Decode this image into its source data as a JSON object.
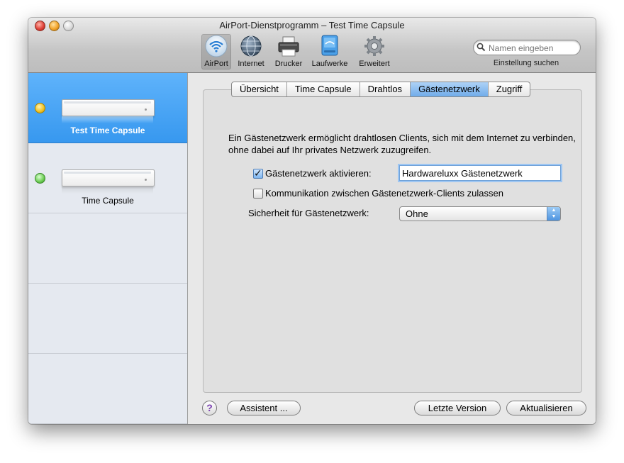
{
  "window": {
    "title": "AirPort-Dienstprogramm – Test Time Capsule"
  },
  "toolbar": {
    "items": [
      {
        "label": "AirPort",
        "icon": "airport-icon",
        "selected": true
      },
      {
        "label": "Internet",
        "icon": "globe-icon"
      },
      {
        "label": "Drucker",
        "icon": "printer-icon"
      },
      {
        "label": "Laufwerke",
        "icon": "disk-icon"
      },
      {
        "label": "Erweitert",
        "icon": "gear-icon"
      }
    ],
    "search": {
      "placeholder": "Namen eingeben",
      "label": "Einstellung suchen"
    }
  },
  "sidebar": {
    "devices": [
      {
        "name": "Test Time Capsule",
        "status": "yellow",
        "selected": true
      },
      {
        "name": "Time Capsule",
        "status": "green",
        "selected": false
      }
    ]
  },
  "tabs": [
    {
      "label": "Übersicht"
    },
    {
      "label": "Time Capsule"
    },
    {
      "label": "Drahtlos"
    },
    {
      "label": "Gästenetzwerk",
      "active": true
    },
    {
      "label": "Zugriff"
    }
  ],
  "guest": {
    "description": "Ein Gästenetzwerk ermöglicht drahtlosen Clients, sich mit dem Internet zu verbinden, ohne dabei auf Ihr privates Netzwerk zuzugreifen.",
    "enable_label": "Gästenetzwerk aktivieren:",
    "enable_checked": true,
    "network_name": "Hardwareluxx Gästenetzwerk",
    "communication_label": "Kommunikation zwischen Gästenetzwerk-Clients zulassen",
    "communication_checked": false,
    "security_label": "Sicherheit für Gästenetzwerk:",
    "security_value": "Ohne"
  },
  "footer": {
    "help": "?",
    "assistant": "Assistent ...",
    "last_version": "Letzte Version",
    "update": "Aktualisieren"
  },
  "colors": {
    "selection_blue": "#3798ef",
    "active_tab": "#70acea"
  }
}
